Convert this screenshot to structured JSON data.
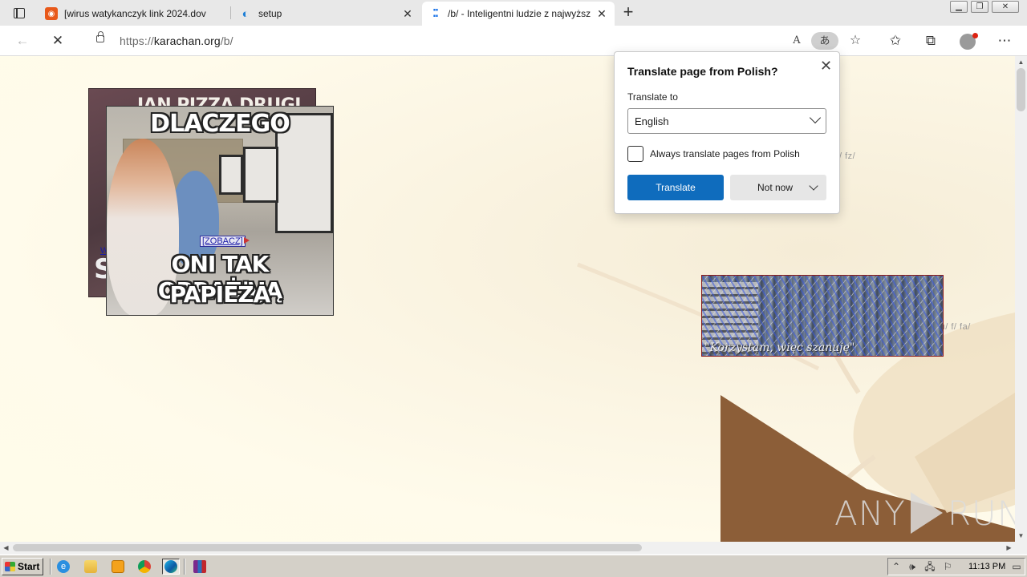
{
  "browser": {
    "tabs": [
      {
        "title": "[wirus watykanczyk link 2024.dov",
        "favicon": "waterfox-orange",
        "active": false
      },
      {
        "title": "setup",
        "favicon": "edge-swirl",
        "active": false
      },
      {
        "title": "/b/ - Inteligentni ludzie z najwyższ",
        "favicon": "karachan-dots",
        "active": true
      }
    ],
    "newtab_label": "+",
    "address": {
      "url_prefix": "https://",
      "url_host": "karachan.org",
      "url_path": "/b/"
    },
    "read_aloud_label": "A",
    "translate_icon_label": "あ"
  },
  "page": {
    "meme_back": {
      "top_text": "JAN PIZZA DRUGI",
      "side_text": "S",
      "link_fragment": "W"
    },
    "meme_front": {
      "top_text": "DLACZEGO",
      "bottom_line1": "ONI TAK OBRAŻAJĄ",
      "bottom_line2": "PAPIEŻA"
    },
    "zobacz_link": "[ZOBACZ]",
    "board_links_top": "/ fz/",
    "board_links_mid": "/ c  a/  edu/  f/  fa/",
    "banner_slogan": "\"Korzystam, więc szanuję\"",
    "watermark_left": "ANY",
    "watermark_right": "RUN"
  },
  "translate_popup": {
    "heading": "Translate page from Polish?",
    "translate_to_label": "Translate to",
    "language_value": "English",
    "checkbox_label": "Always translate pages from Polish",
    "checkbox_checked": false,
    "primary_button": "Translate",
    "secondary_button": "Not now",
    "accent_color": "#0f6cbd"
  },
  "taskbar": {
    "start_label": "Start",
    "clock": "11:13 PM",
    "apps": [
      "internet-explorer-icon",
      "folder-icon",
      "media-player-icon",
      "chrome-icon",
      "edge-icon",
      "winrar-icon"
    ]
  }
}
